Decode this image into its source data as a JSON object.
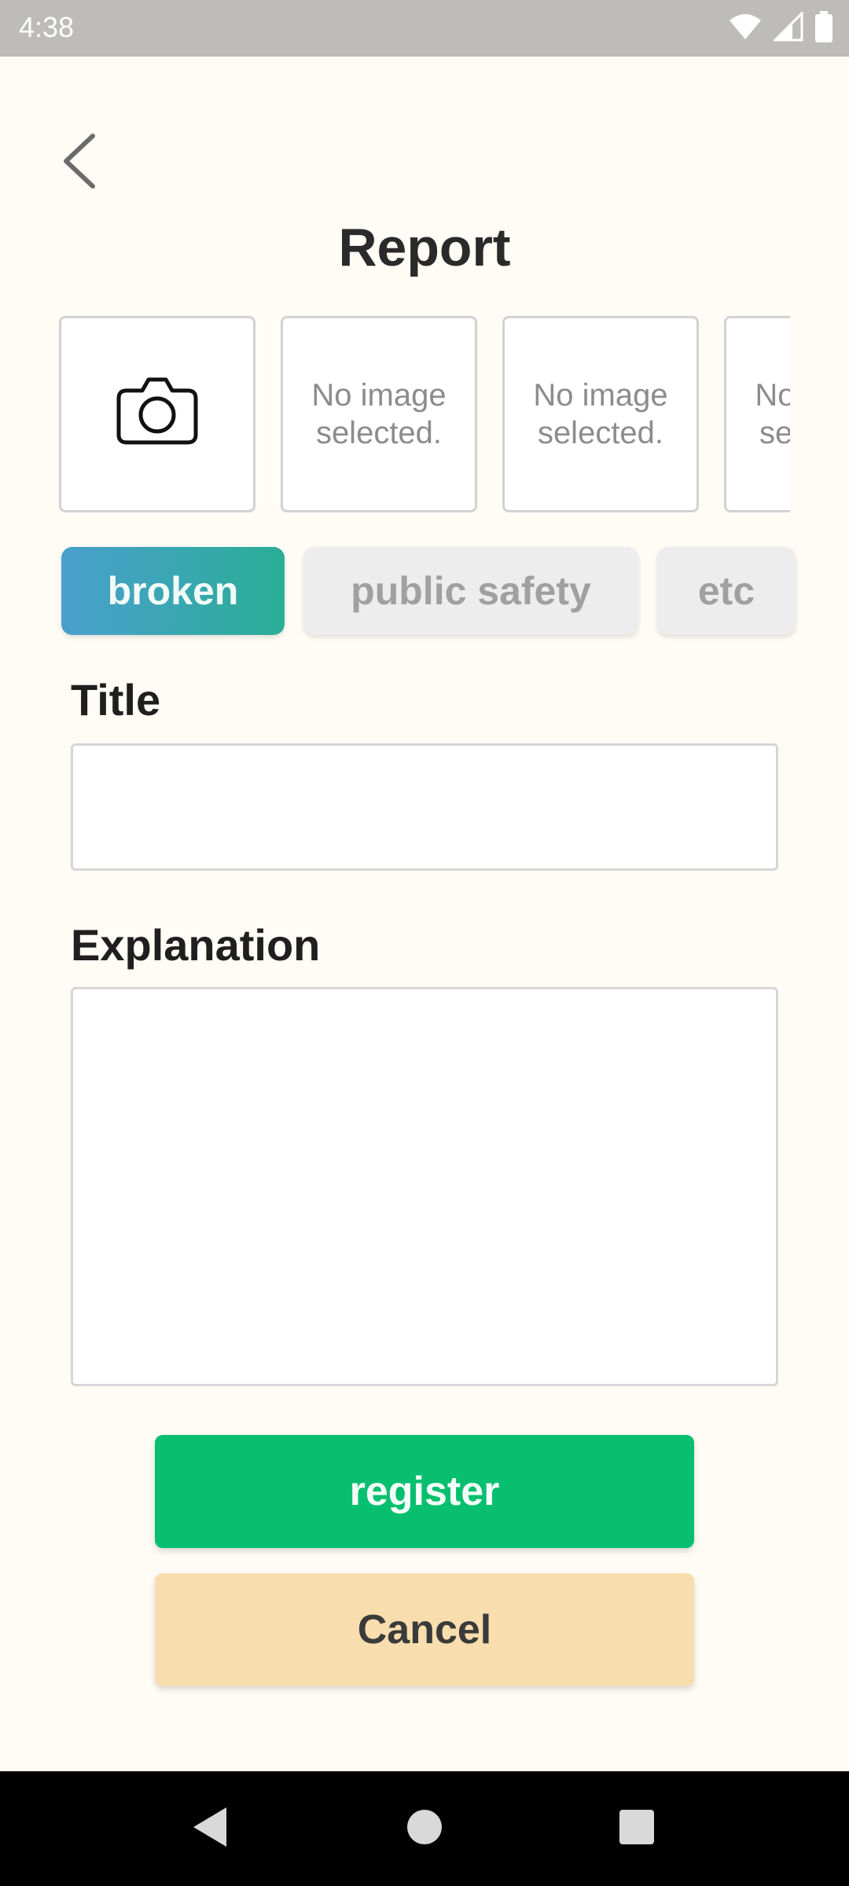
{
  "status_bar": {
    "time": "4:38",
    "icons": [
      "wifi-icon",
      "signal-icon",
      "battery-icon"
    ]
  },
  "header": {
    "back_icon": "chevron-left-icon",
    "title": "Report"
  },
  "images": {
    "add_icon": "camera-icon",
    "slots": [
      {
        "text": "No image selected."
      },
      {
        "text": "No image selected."
      },
      {
        "text": "No image selected."
      }
    ]
  },
  "categories": {
    "items": [
      {
        "label": "broken",
        "selected": true
      },
      {
        "label": "public safety",
        "selected": false
      },
      {
        "label": "etc",
        "selected": false
      }
    ]
  },
  "form": {
    "title_label": "Title",
    "title_value": "",
    "explanation_label": "Explanation",
    "explanation_value": ""
  },
  "actions": {
    "register_label": "register",
    "cancel_label": "Cancel"
  },
  "colors": {
    "background": "#FFFBF5",
    "status_bar": "#BDBCB8",
    "chip_selected_start": "#4A9FCE",
    "chip_selected_end": "#2AAE96",
    "chip_unselected": "#EDEDED",
    "register": "#08BF70",
    "cancel": "#F8DDAE"
  },
  "nav_bar": {
    "icons": [
      "back-triangle-icon",
      "home-circle-icon",
      "recents-square-icon"
    ]
  }
}
